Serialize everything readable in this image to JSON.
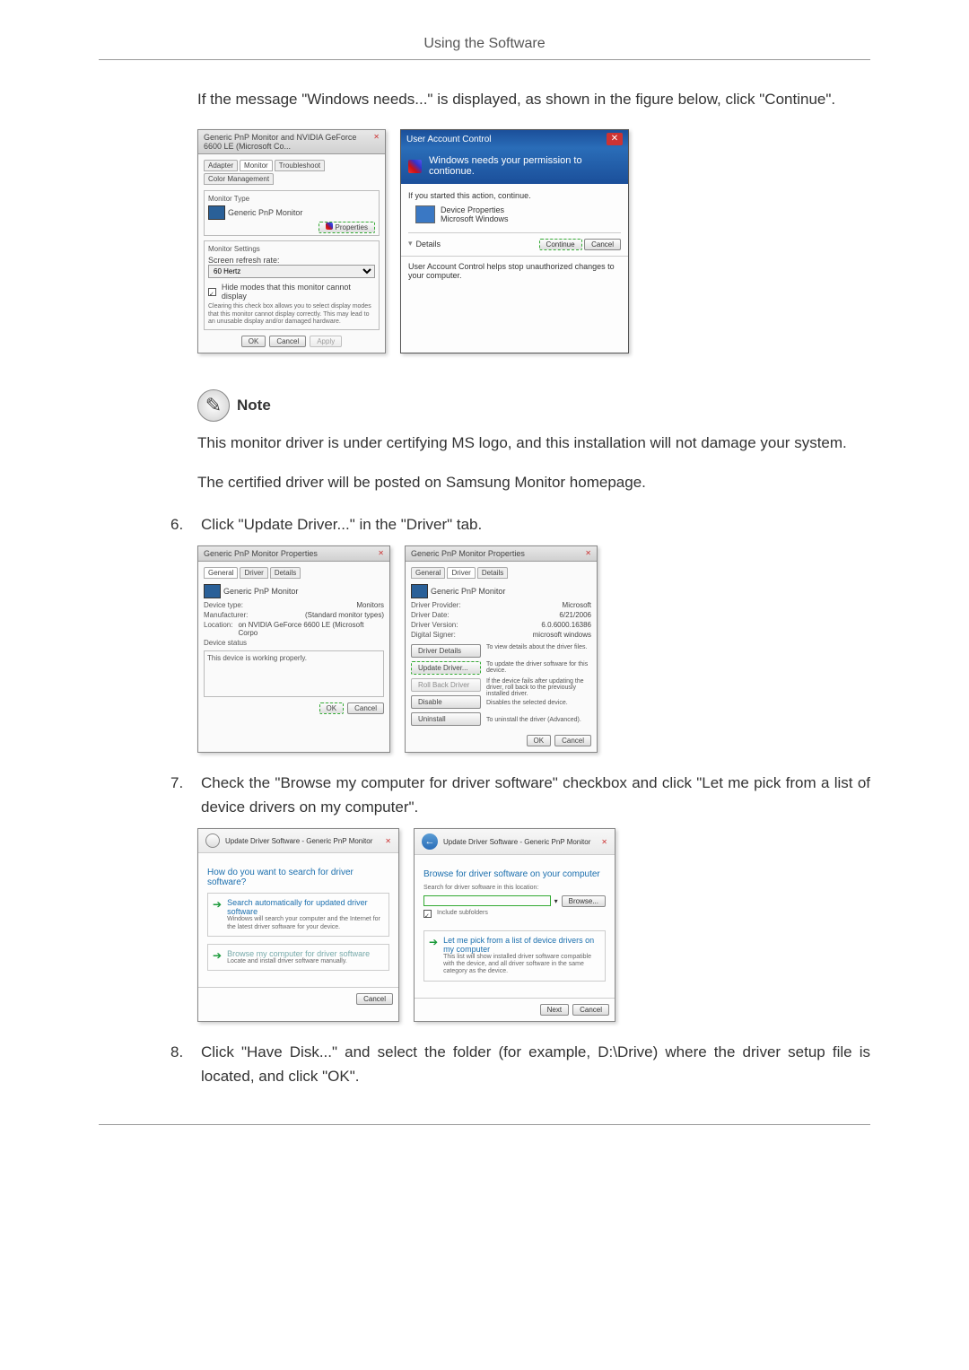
{
  "header": "Using the Software",
  "intro": "If the message \"Windows needs...\" is displayed, as shown in the figure below, click \"Continue\".",
  "monitor_dialog": {
    "title": "Generic PnP Monitor and NVIDIA GeForce 6600 LE (Microsoft Co...",
    "tabs": [
      "Adapter",
      "Monitor",
      "Troubleshoot",
      "Color Management"
    ],
    "grp1_title": "Monitor Type",
    "monitor_name": "Generic PnP Monitor",
    "properties_btn": "Properties",
    "grp2_title": "Monitor Settings",
    "refresh_label": "Screen refresh rate:",
    "refresh_value": "60 Hertz",
    "hide_modes": "Hide modes that this monitor cannot display",
    "hide_desc": "Clearing this check box allows you to select display modes that this monitor cannot display correctly. This may lead to an unusable display and/or damaged hardware.",
    "ok": "OK",
    "cancel": "Cancel",
    "apply": "Apply"
  },
  "uac": {
    "title": "User Account Control",
    "banner": "Windows needs your permission to contionue.",
    "started": "If you started this action, continue.",
    "app_name": "Device Properties",
    "app_pub": "Microsoft Windows",
    "details": "Details",
    "continue": "Continue",
    "cancel": "Cancel",
    "footer": "User Account Control helps stop unauthorized changes to your computer."
  },
  "note": {
    "label": "Note",
    "text1": "This monitor driver is under certifying MS logo, and this installation will not damage your system.",
    "text2": "The certified driver will be posted on Samsung Monitor homepage."
  },
  "step6": {
    "num": "6.",
    "text": "Click \"Update Driver...\" in the \"Driver\" tab."
  },
  "props_general": {
    "title": "Generic PnP Monitor Properties",
    "tab_general": "General",
    "tab_driver": "Driver",
    "tab_details": "Details",
    "monitor_name": "Generic PnP Monitor",
    "device_type_lbl": "Device type:",
    "device_type": "Monitors",
    "manufacturer_lbl": "Manufacturer:",
    "manufacturer": "(Standard monitor types)",
    "location_lbl": "Location:",
    "location": "on NVIDIA GeForce 6600 LE (Microsoft Corpo",
    "status_lbl": "Device status",
    "status_text": "This device is working properly.",
    "ok": "OK",
    "cancel": "Cancel"
  },
  "props_driver": {
    "title": "Generic PnP Monitor Properties",
    "monitor_name": "Generic PnP Monitor",
    "provider_lbl": "Driver Provider:",
    "provider": "Microsoft",
    "date_lbl": "Driver Date:",
    "date": "6/21/2006",
    "version_lbl": "Driver Version:",
    "version": "6.0.6000.16386",
    "signer_lbl": "Digital Signer:",
    "signer": "microsoft windows",
    "details_btn": "Driver Details",
    "details_desc": "To view details about the driver files.",
    "update_btn": "Update Driver...",
    "update_desc": "To update the driver software for this device.",
    "rollback_btn": "Roll Back Driver",
    "rollback_desc": "If the device fails after updating the driver, roll back to the previously installed driver.",
    "disable_btn": "Disable",
    "disable_desc": "Disables the selected device.",
    "uninstall_btn": "Uninstall",
    "uninstall_desc": "To uninstall the driver (Advanced).",
    "ok": "OK",
    "cancel": "Cancel"
  },
  "step7": {
    "num": "7.",
    "text": "Check the \"Browse my computer for driver software\" checkbox and click \"Let me pick from a list of device drivers on my computer\"."
  },
  "wiz1": {
    "breadcrumb": "Update Driver Software - Generic PnP Monitor",
    "heading": "How do you want to search for driver software?",
    "opt1_title": "Search automatically for updated driver software",
    "opt1_desc": "Windows will search your computer and the Internet for the latest driver software for your device.",
    "opt2_title": "Browse my computer for driver software",
    "opt2_desc": "Locate and install driver software manually.",
    "cancel": "Cancel"
  },
  "wiz2": {
    "breadcrumb": "Update Driver Software - Generic PnP Monitor",
    "heading": "Browse for driver software on your computer",
    "search_lbl": "Search for driver software in this location:",
    "browse": "Browse...",
    "include_sub": "Include subfolders",
    "letme_title": "Let me pick from a list of device drivers on my computer",
    "letme_desc": "This list will show installed driver software compatible with the device, and all driver software in the same category as the device.",
    "next": "Next",
    "cancel": "Cancel"
  },
  "step8": {
    "num": "8.",
    "text": "Click \"Have Disk...\" and select the folder (for example, D:\\Drive) where the driver setup file is located, and click \"OK\"."
  }
}
